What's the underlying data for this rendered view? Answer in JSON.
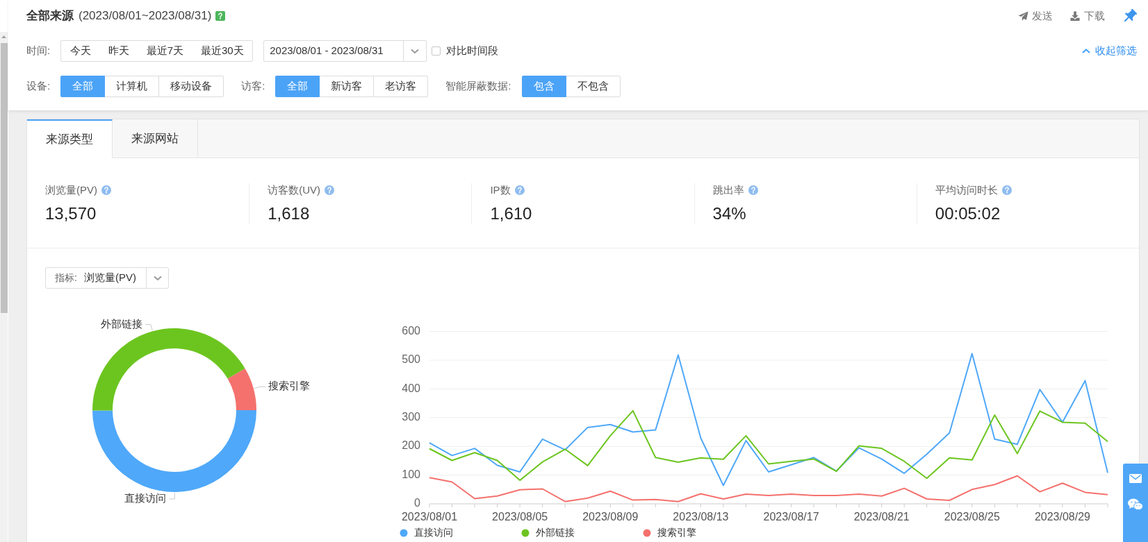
{
  "header": {
    "title": "全部来源",
    "date_range": "(2023/08/01~2023/08/31)",
    "actions": [
      {
        "kind": "send",
        "label": "发送"
      },
      {
        "kind": "download",
        "label": "下载"
      }
    ]
  },
  "filters": {
    "time": {
      "label": "时间:",
      "options": [
        {
          "label": "今天",
          "selected": false
        },
        {
          "label": "昨天",
          "selected": false
        },
        {
          "label": "最近7天",
          "selected": false
        },
        {
          "label": "最近30天",
          "selected": false
        }
      ],
      "date_range": "2023/08/01 - 2023/08/31",
      "compare": {
        "label": "对比时间段",
        "checked": false
      }
    },
    "collapse_link": "收起筛选",
    "groups": [
      {
        "label": "设备:",
        "options": [
          {
            "label": "全部",
            "selected": true
          },
          {
            "label": "计算机",
            "selected": false
          },
          {
            "label": "移动设备",
            "selected": false
          }
        ]
      },
      {
        "label": "访客:",
        "options": [
          {
            "label": "全部",
            "selected": true
          },
          {
            "label": "新访客",
            "selected": false
          },
          {
            "label": "老访客",
            "selected": false
          }
        ]
      },
      {
        "label": "智能屏蔽数据:",
        "options": [
          {
            "label": "包含",
            "selected": true
          },
          {
            "label": "不包含",
            "selected": false
          }
        ]
      }
    ]
  },
  "tabs": [
    {
      "label": "来源类型",
      "selected": true
    },
    {
      "label": "来源网站",
      "selected": false
    }
  ],
  "stats": [
    {
      "label": "浏览量(PV)",
      "value": "13,570"
    },
    {
      "label": "访客数(UV)",
      "value": "1,618"
    },
    {
      "label": "IP数",
      "value": "1,610"
    },
    {
      "label": "跳出率",
      "value": "34%"
    },
    {
      "label": "平均访问时长",
      "value": "00:05:02"
    }
  ],
  "metric_select": {
    "label": "指标:",
    "value": "浏览量(PV)"
  },
  "donut": {
    "slices": [
      {
        "label": "直接访问",
        "color": "#4fa8f9"
      },
      {
        "label": "外部链接",
        "color": "#6cc51f"
      },
      {
        "label": "搜索引擎",
        "color": "#f4716d"
      }
    ]
  },
  "trend_chart": {
    "chart_data": {
      "type": "line",
      "categories": [
        "2023/08/01",
        null,
        null,
        null,
        "2023/08/05",
        null,
        null,
        null,
        "2023/08/09",
        null,
        null,
        null,
        "2023/08/13",
        null,
        null,
        null,
        "2023/08/17",
        null,
        null,
        null,
        "2023/08/21",
        null,
        null,
        null,
        "2023/08/25",
        null,
        null,
        null,
        "2023/08/29",
        null,
        null
      ],
      "series": [
        {
          "name": "直接访问",
          "color": "#4fa8f9",
          "values": [
            212,
            168,
            193,
            134,
            111,
            225,
            188,
            266,
            276,
            250,
            257,
            518,
            229,
            64,
            220,
            111,
            136,
            161,
            114,
            195,
            156,
            106,
            173,
            247,
            523,
            225,
            207,
            398,
            284,
            429,
            108
          ]
        },
        {
          "name": "外部链接",
          "color": "#6cc51f",
          "values": [
            192,
            151,
            178,
            151,
            82,
            146,
            190,
            133,
            237,
            324,
            161,
            145,
            160,
            155,
            237,
            139,
            148,
            156,
            113,
            202,
            193,
            148,
            89,
            160,
            153,
            309,
            175,
            323,
            284,
            281,
            217
          ]
        },
        {
          "name": "搜索引擎",
          "color": "#f4716d",
          "values": [
            91,
            76,
            18,
            27,
            49,
            52,
            8,
            20,
            44,
            13,
            15,
            8,
            35,
            17,
            34,
            29,
            34,
            29,
            29,
            34,
            27,
            54,
            17,
            12,
            50,
            67,
            97,
            42,
            72,
            40,
            32
          ]
        }
      ],
      "ylim": [
        0,
        600
      ],
      "yticks": [
        0,
        100,
        200,
        300,
        400,
        500,
        600
      ],
      "grid": true,
      "legend": true
    }
  }
}
